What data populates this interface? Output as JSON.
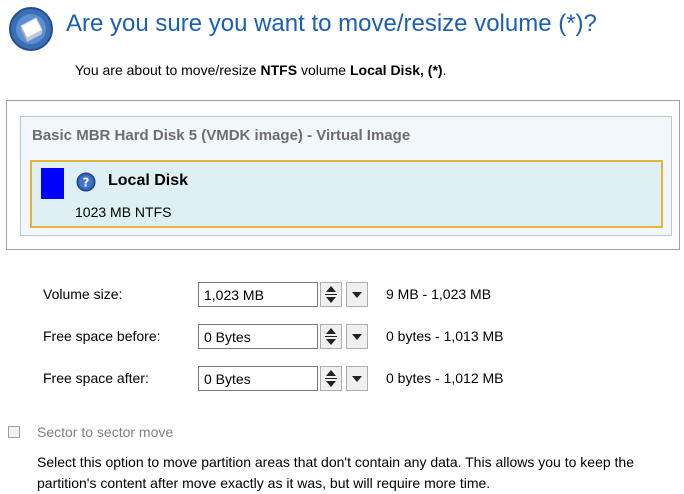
{
  "header": {
    "title": "Are you sure you want to move/resize volume (*)?",
    "subtitle_prefix": "You are about to move/resize ",
    "subtitle_fs": "NTFS",
    "subtitle_middle": " volume ",
    "subtitle_volume": "Local Disk, (*)",
    "subtitle_suffix": "."
  },
  "disk": {
    "header": "Basic MBR Hard Disk 5 (VMDK image) - Virtual Image",
    "partition": {
      "name": "Local Disk",
      "info": "1023 MB NTFS",
      "color": "#0000ff"
    }
  },
  "fields": [
    {
      "label": "Volume size:",
      "value": "1,023 MB",
      "range": "9 MB - 1,023 MB"
    },
    {
      "label": "Free space before:",
      "value": "0 Bytes",
      "range": "0 bytes - 1,013 MB"
    },
    {
      "label": "Free space after:",
      "value": "0 Bytes",
      "range": "0 bytes - 1,012 MB"
    }
  ],
  "options": {
    "sector_move_label": "Sector to sector move",
    "sector_move_checked": false,
    "sector_move_description": "Select this option to move partition areas that don't contain any data. This allows you to keep the partition's content after move exactly as it was, but will require more time."
  },
  "icons": {
    "app": "disk-wizard-icon",
    "help": "help-icon",
    "spin": "spin-arrows-icon",
    "dropdown": "dropdown-arrow-icon"
  }
}
